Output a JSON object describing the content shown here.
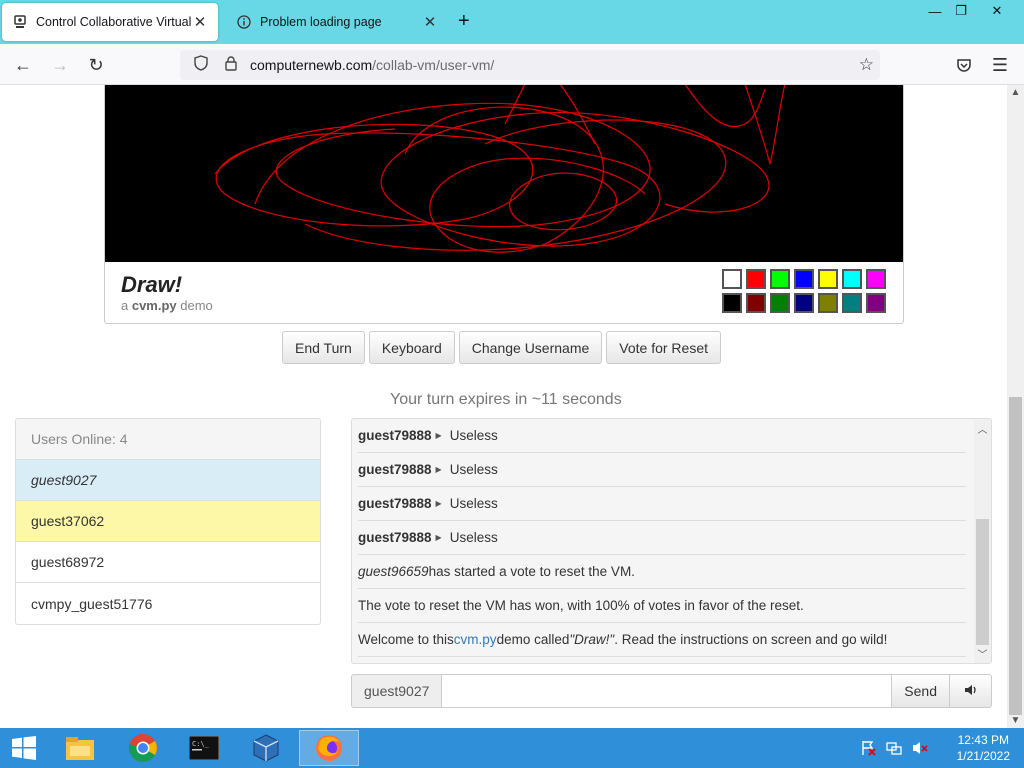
{
  "browser": {
    "tabs": [
      {
        "title": "Control Collaborative Virtual M",
        "icon": "vm-favicon-icon",
        "active": true
      },
      {
        "title": "Problem loading page",
        "icon": "info-icon",
        "active": false
      }
    ],
    "url_host": "computernewb.com",
    "url_path": "/collab-vm/user-vm/"
  },
  "vm": {
    "title": "Draw!",
    "subtitle_prefix": "a ",
    "subtitle_bold": "cvm.py",
    "subtitle_suffix": " demo",
    "palette": [
      "#ffffff",
      "#ff0000",
      "#00ff00",
      "#0000ff",
      "#ffff00",
      "#00ffff",
      "#ff00ff",
      "#000000",
      "#800000",
      "#008000",
      "#000080",
      "#808000",
      "#008080",
      "#800080"
    ]
  },
  "buttons": {
    "end_turn": "End Turn",
    "keyboard": "Keyboard",
    "change_username": "Change Username",
    "vote_reset": "Vote for Reset"
  },
  "turn_text": "Your turn expires in ~11 seconds",
  "users": {
    "header": "Users Online: 4",
    "list": [
      "guest9027",
      "guest37062",
      "guest68972",
      "cvmpy_guest51776"
    ]
  },
  "chat": {
    "messages": [
      {
        "user": "guest79888",
        "text": "Useless"
      },
      {
        "user": "guest79888",
        "text": "Useless"
      },
      {
        "user": "guest79888",
        "text": "Useless"
      },
      {
        "user": "guest79888",
        "text": "Useless"
      }
    ],
    "vote_user": "guest96659",
    "vote_text": " has started a vote to reset the VM.",
    "vote_won": "The vote to reset the VM has won, with 100% of votes in favor of the reset.",
    "welcome_prefix": "Welcome to this ",
    "welcome_link": "cvm.py",
    "welcome_mid": " demo called ",
    "welcome_name": "\"Draw!\"",
    "welcome_suffix": ". Read the instructions on screen and go wild!"
  },
  "input": {
    "username": "guest9027",
    "value": "",
    "send_label": "Send"
  },
  "taskbar": {
    "time": "12:43 PM",
    "date": "1/21/2022"
  }
}
